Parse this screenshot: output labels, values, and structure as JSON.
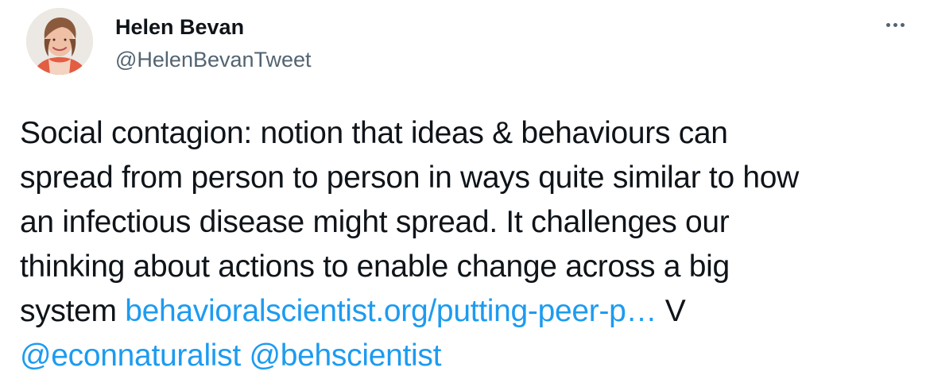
{
  "author": {
    "display_name": "Helen Bevan",
    "handle": "@HelenBevanTweet"
  },
  "menu": {
    "more_icon": "more-horizontal-icon"
  },
  "tweet": {
    "line1": "Social contagion: notion that ideas & behaviours can",
    "line2": "spread from person to person in ways quite similar to how",
    "line3": "an infectious disease might spread. It challenges our",
    "line4": "thinking about actions to enable change across a big",
    "line5_text": "system ",
    "line5_link": "behavioralscientist.org/putting-peer-p…",
    "line5_after": " V",
    "mention1": "@econnaturalist",
    "mention_separator": " ",
    "mention2": "@behscientist"
  },
  "colors": {
    "link": "#1d9bf0",
    "secondary_text": "#536471",
    "primary_text": "#0f1419"
  }
}
